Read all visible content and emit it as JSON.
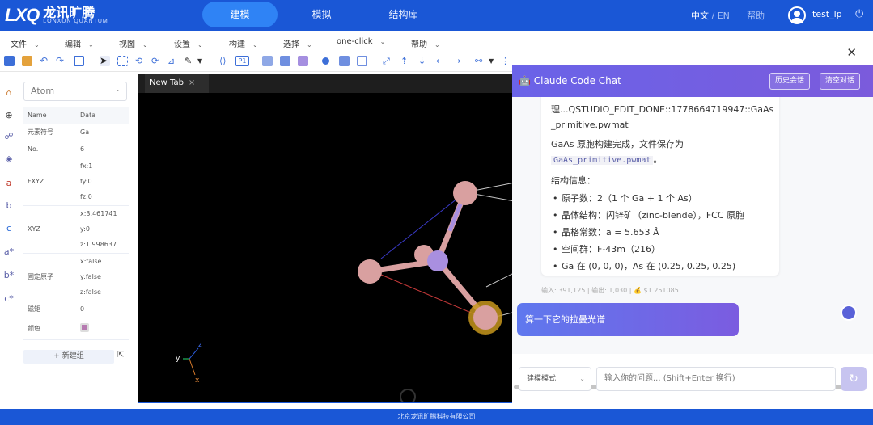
{
  "header": {
    "logo_mark": "LXQ",
    "logo_cn": "龙讯旷腾",
    "logo_en": "LONXUN QUANTUM",
    "nav": [
      "建模",
      "模拟",
      "结构库"
    ],
    "lang_active": "中文",
    "lang_sep": " / ",
    "lang_other": "EN",
    "help": "帮助",
    "username": "test_lp",
    "colors": {
      "header_bg": "#1a57d6",
      "nav_active": "#2f83f5"
    }
  },
  "menu": [
    "文件",
    "编辑",
    "视图",
    "设置",
    "构建",
    "选择",
    "one-click",
    "帮助"
  ],
  "toolbar": {
    "p1_label": "P1"
  },
  "left_strip": [
    "a",
    "b",
    "c",
    "a*",
    "b*",
    "c*"
  ],
  "panel": {
    "selector": "Atom",
    "col_name": "Name",
    "col_data": "Data",
    "rows": [
      {
        "k": "元素符号",
        "v": [
          "Ga"
        ]
      },
      {
        "k": "No.",
        "v": [
          "6"
        ]
      },
      {
        "k": "FXYZ",
        "v": [
          "fx:1",
          "fy:0",
          "fz:0"
        ]
      },
      {
        "k": "XYZ",
        "v": [
          "x:3.461741",
          "y:0",
          "z:1.998637"
        ]
      },
      {
        "k": "固定原子",
        "v": [
          "x:false",
          "y:false",
          "z:false"
        ]
      },
      {
        "k": "磁矩",
        "v": [
          "0"
        ]
      },
      {
        "k": "颜色",
        "v": []
      }
    ],
    "new_group": "+ 新建组"
  },
  "tab": {
    "label": "New Tab",
    "close": "×"
  },
  "axes": {
    "x": "x",
    "y": "y",
    "z": "z"
  },
  "chat": {
    "title": "Claude Code Chat",
    "history_btn": "历史会话",
    "clear_btn": "清空对话",
    "bubble_line1": "理...QSTUDIO_EDIT_DONE::1778664719947::GaAs",
    "bubble_line2": "_primitive.pwmat",
    "done_text": "GaAs 原胞构建完成，文件保存为",
    "file_name": "GaAs_primitive.pwmat",
    "done_end": "。",
    "info_title": "结构信息：",
    "info_items": [
      "原子数：2（1 个 Ga + 1 个 As）",
      "晶体结构：闪锌矿（zinc-blende），FCC 原胞",
      "晶格常数：a = 5.653 Å",
      "空间群：F-43m（216）",
      "Ga 在 (0, 0, 0)，As 在 (0.25, 0.25, 0.25)"
    ],
    "tokens": "输入: 391,125  |  输出: 1,030  |  💰 $1.251085",
    "user_msg": "算一下它的拉曼光谱",
    "mode": "建模模式",
    "input_placeholder": "输入你的问题... (Shift+Enter 换行)",
    "send_icon": "↻",
    "colors": {
      "header_from": "#6a63e8",
      "header_to": "#7b5bdc"
    }
  },
  "footer": "北京龙讯旷腾科技有限公司"
}
